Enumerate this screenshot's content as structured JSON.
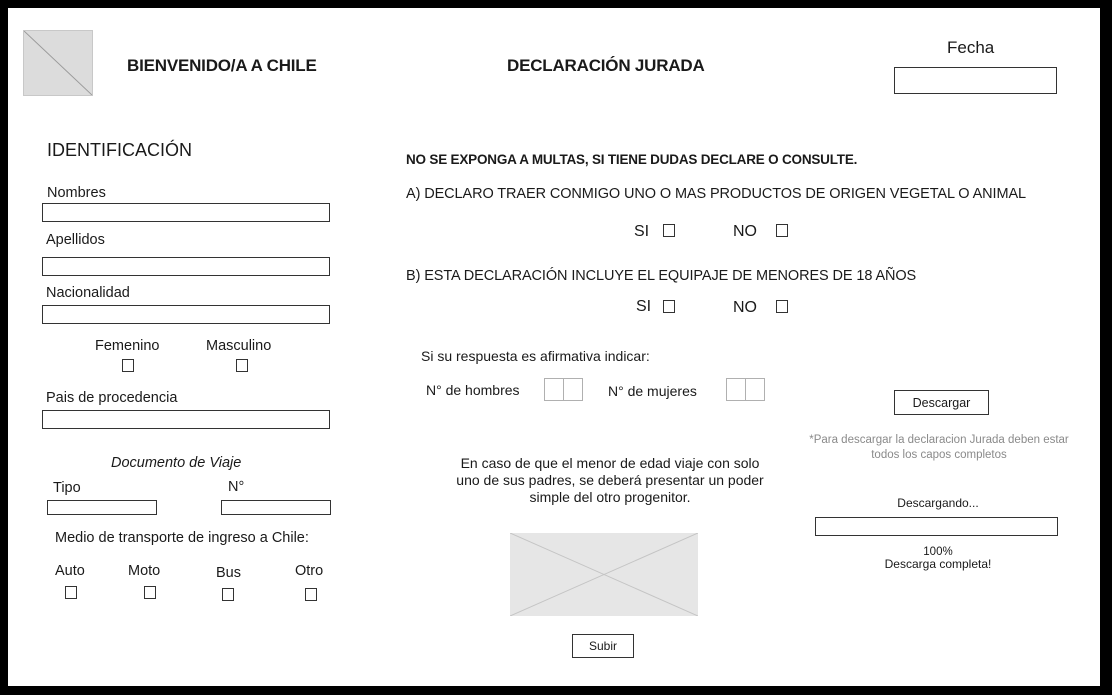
{
  "header": {
    "welcome": "BIENVENIDO/A A CHILE",
    "declaration": "DECLARACIÓN JURADA",
    "date_label": "Fecha",
    "date_value": ""
  },
  "identification": {
    "heading": "IDENTIFICACIÓN",
    "nombres_label": "Nombres",
    "apellidos_label": "Apellidos",
    "nacionalidad_label": "Nacionalidad",
    "femenino_label": "Femenino",
    "masculino_label": "Masculino",
    "pais_label": "Pais de procedencia",
    "documento_heading": "Documento de Viaje",
    "tipo_label": "Tipo",
    "numero_label": "N°",
    "transporte_label": "Medio de transporte de ingreso a Chile:",
    "transport_options": [
      "Auto",
      "Moto",
      "Bus",
      "Otro"
    ]
  },
  "declaration": {
    "warning": "NO SE EXPONGA A MULTAS, SI TIENE DUDAS DECLARE O CONSULTE.",
    "question_a": "A) DECLARO TRAER CONMIGO UNO O MAS PRODUCTOS DE ORIGEN VEGETAL O ANIMAL",
    "question_b": "B) ESTA DECLARACIÓN INCLUYE EL EQUIPAJE DE MENORES DE 18 AÑOS",
    "si_label": "SI",
    "no_label": "NO",
    "affirmative_hint": "Si su respuesta es afirmativa indicar:",
    "hombres_label": "N° de hombres",
    "mujeres_label": "N° de mujeres",
    "minor_note": "En caso de que el menor de edad viaje con solo uno de sus padres, se deberá presentar un poder simple del otro progenitor.",
    "upload_button": "Subir"
  },
  "download": {
    "button": "Descargar",
    "note": "*Para descargar la declaracion Jurada deben estar todos los capos completos",
    "status": "Descargando...",
    "progress": 1.0,
    "percent_text": "100%",
    "complete_text": "Descarga completa!"
  }
}
